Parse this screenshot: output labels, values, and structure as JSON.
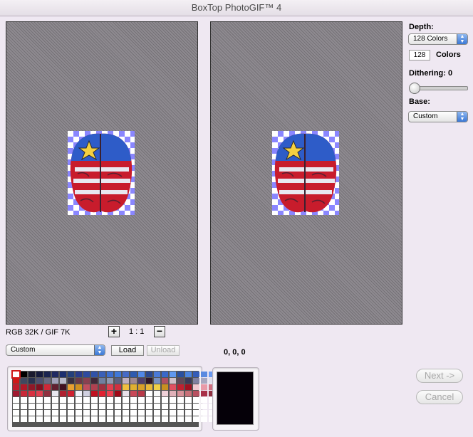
{
  "window": {
    "title": "BoxTop PhotoGIF™ 4"
  },
  "depth": {
    "label": "Depth:",
    "popup_value": "128 Colors",
    "field_value": "128",
    "field_suffix": "Colors"
  },
  "dithering": {
    "label": "Dithering: 0",
    "value": 0
  },
  "base": {
    "label": "Base:",
    "popup_value": "Custom"
  },
  "sizes": {
    "text": "RGB 32K / GIF 7K"
  },
  "zoom": {
    "plus": "+",
    "value": "1 : 1",
    "minus": "−"
  },
  "palette_popup": {
    "value": "Custom"
  },
  "palette_buttons": {
    "load": "Load",
    "unload": "Unload"
  },
  "color_readout": "0, 0, 0",
  "buttons": {
    "next": "Next ->",
    "cancel": "Cancel"
  },
  "palette_colors": [
    [
      "#ffffff",
      "#000000",
      "#1a1a2e",
      "#151a3c",
      "#1a2450",
      "#202a62",
      "#1c2f70",
      "#24407c",
      "#2a3c8c",
      "#2e4aa0",
      "#3052a8",
      "#3a60b8",
      "#3c6ed0",
      "#3f78d8",
      "#466ac6",
      "#2d5ab0",
      "#5088e8",
      "#2a4890",
      "#4a7ad8",
      "#3a68c8",
      "#6098f0",
      "#2a50a0",
      "#4c84e0",
      "#345cb8",
      "#5a8ae0",
      "#6a9af0"
    ],
    [
      "#d01818",
      "#404860",
      "#2a3250",
      "#4c5070",
      "#686880",
      "#a0a0b8",
      "#b8b8c8",
      "#383040",
      "#6a3a48",
      "#8a4050",
      "#402838",
      "#7080a0",
      "#9098b0",
      "#5a6080",
      "#c0b0c0",
      "#a08890",
      "#50406a",
      "#301828",
      "#7890c0",
      "#b05060",
      "#d0c0c8",
      "#604858",
      "#3a3a58",
      "#8080a0",
      "#a8a8c0",
      "#e0e0ec"
    ],
    [
      "#c01c2c",
      "#b01828",
      "#901828",
      "#801020",
      "#d02838",
      "#602030",
      "#401020",
      "#e8a030",
      "#d09020",
      "#c05060",
      "#b04050",
      "#a03040",
      "#e04050",
      "#d03040",
      "#f0c040",
      "#e0b030",
      "#d8a028",
      "#e8b838",
      "#f0d048",
      "#c89020",
      "#e05060",
      "#c02030",
      "#a01020",
      "#f0c8d0",
      "#e89aa8",
      "#d07080"
    ],
    [
      "#a01830",
      "#c82838",
      "#d83040",
      "#e04050",
      "#903040",
      "#e8e8f0",
      "#b02030",
      "#d02030",
      "#f0f0f8",
      "#d0d0e0",
      "#c01020",
      "#e02030",
      "#f04050",
      "#a00818",
      "#e8e0e8",
      "#c84858",
      "#b83848",
      "#ffffff",
      "#f8f8f8",
      "#f0d0d8",
      "#e0b0b8",
      "#d89098",
      "#c87078",
      "#b85060",
      "#a83048",
      "#903040"
    ]
  ]
}
